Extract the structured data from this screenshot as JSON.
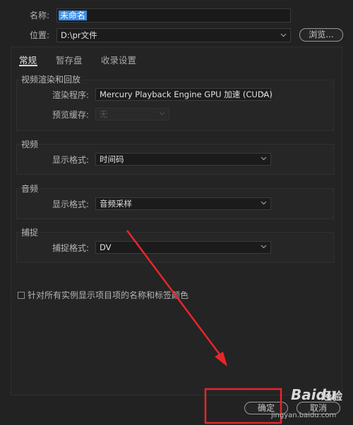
{
  "header": {
    "name_label": "名称:",
    "name_value": "未命名",
    "location_label": "位置:",
    "location_value": "D:\\pr文件",
    "browse_label": "浏览..."
  },
  "tabs": [
    {
      "label": "常规",
      "active": true
    },
    {
      "label": "暂存盘",
      "active": false
    },
    {
      "label": "收录设置",
      "active": false
    }
  ],
  "video_rendering": {
    "title": "视频渲染和回放",
    "renderer_label": "渲染程序:",
    "renderer_value": "Mercury Playback Engine GPU 加速 (CUDA)",
    "preview_cache_label": "预览缓存:",
    "preview_cache_value": "无"
  },
  "video": {
    "title": "视频",
    "display_format_label": "显示格式:",
    "display_format_value": "时间码"
  },
  "audio": {
    "title": "音频",
    "display_format_label": "显示格式:",
    "display_format_value": "音频采样"
  },
  "capture": {
    "title": "捕捉",
    "capture_format_label": "捕捉格式:",
    "capture_format_value": "DV"
  },
  "checkbox": {
    "label": "针对所有实例显示项目项的名称和标签颜色",
    "checked": false
  },
  "footer": {
    "ok_label": "确定",
    "cancel_label": "取消"
  },
  "watermark": {
    "brand": "Baidu",
    "jingyan": "经验",
    "url": "jingyan.baidu.com"
  },
  "colors": {
    "background": "#222222",
    "selection": "#3a8de8",
    "annotation_red": "#e8262a"
  }
}
